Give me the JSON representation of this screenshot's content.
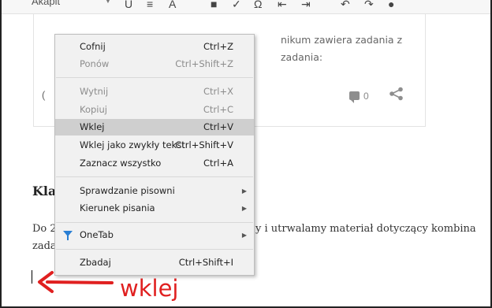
{
  "toolbar": {
    "format_label": "Akapit"
  },
  "card": {
    "text_line1": "nikum zawiera zadania z",
    "text_line2": "zadania:",
    "paren": "(",
    "comment_count": "0"
  },
  "article": {
    "heading": "Kla",
    "para_line1_start": "Do 2",
    "para_line1_end": "y i utrwalamy materiał dotyczący kombina",
    "para_line2_start": "zada"
  },
  "annotation": {
    "text": "wklej",
    "color": "#e02020"
  },
  "context_menu": {
    "items": [
      {
        "label": "Cofnij",
        "shortcut": "Ctrl+Z"
      },
      {
        "label": "Ponów",
        "shortcut": "Ctrl+Shift+Z"
      },
      {
        "label": "Wytnij",
        "shortcut": "Ctrl+X"
      },
      {
        "label": "Kopiuj",
        "shortcut": "Ctrl+C"
      },
      {
        "label": "Wklej",
        "shortcut": "Ctrl+V"
      },
      {
        "label": "Wklej jako zwykły tekst",
        "shortcut": "Ctrl+Shift+V"
      },
      {
        "label": "Zaznacz wszystko",
        "shortcut": "Ctrl+A"
      },
      {
        "label": "Sprawdzanie pisowni",
        "shortcut": ""
      },
      {
        "label": "Kierunek pisania",
        "shortcut": ""
      },
      {
        "label": "OneTab",
        "shortcut": ""
      },
      {
        "label": "Zbadaj",
        "shortcut": "Ctrl+Shift+I"
      }
    ],
    "highlight_color": "#cfcfcf"
  }
}
